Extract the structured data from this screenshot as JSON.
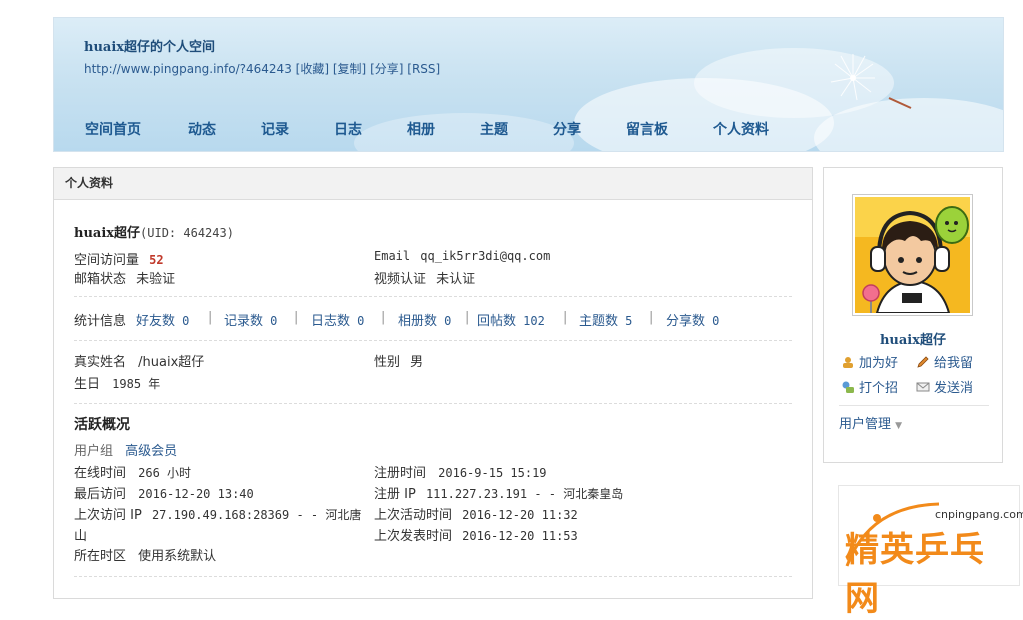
{
  "header": {
    "title": "huaix超仔的个人空间",
    "url": "http://www.pingpang.info/?464243",
    "url_links": [
      "[收藏]",
      "[复制]",
      "[分享]",
      "[RSS]"
    ]
  },
  "nav": [
    "空间首页",
    "动态",
    "记录",
    "日志",
    "相册",
    "主题",
    "分享",
    "留言板",
    "个人资料"
  ],
  "main": {
    "head_title": "个人资料",
    "username": "huaix超仔",
    "uid": "(UID: 464243)",
    "visits_label": "空间访问量",
    "visits_value": "52",
    "email_label": "Email",
    "email_value": "qq_ik5rr3di@qq.com",
    "mail_status_label": "邮箱状态",
    "mail_status_value": "未验证",
    "video_label": "视频认证",
    "video_value": "未认证",
    "stats_label": "统计信息",
    "stats": [
      {
        "label": "好友数",
        "value": "0"
      },
      {
        "label": "记录数",
        "value": "0"
      },
      {
        "label": "日志数",
        "value": "0"
      },
      {
        "label": "相册数",
        "value": "0"
      },
      {
        "label": "回帖数",
        "value": "102"
      },
      {
        "label": "主题数",
        "value": "5"
      },
      {
        "label": "分享数",
        "value": "0"
      }
    ],
    "realname_label": "真实姓名",
    "realname_value": "/huaix超仔",
    "gender_label": "性别",
    "gender_value": "男",
    "birthday_label": "生日",
    "birthday_value": "1985 年",
    "activity_title": "活跃概况",
    "group_label": "用户组",
    "group_value": "高级会员",
    "online_label": "在线时间",
    "online_value": "266 小时",
    "reg_time_label": "注册时间",
    "reg_time_value": "2016-9-15 15:19",
    "last_visit_label": "最后访问",
    "last_visit_value": "2016-12-20 13:40",
    "reg_ip_label": "注册 IP",
    "reg_ip_value": "111.227.23.191 - - 河北秦皇岛",
    "prev_ip_label": "上次访问 IP",
    "prev_ip_value": "27.190.49.168:28369 - - 河北唐",
    "prev_ip_wrap": "山",
    "last_active_label": "上次活动时间",
    "last_active_value": "2016-12-20 11:32",
    "last_post_label": "上次发表时间",
    "last_post_value": "2016-12-20 11:53",
    "tz_label": "所在时区",
    "tz_value": "使用系统默认"
  },
  "sidebar": {
    "name": "huaix超仔",
    "add_friend": "加为好",
    "leave_msg": "给我留",
    "greet": "打个招",
    "send_msg": "发送消",
    "user_manage": "用户管理"
  },
  "ad": {
    "domain": "cnpingpang.com",
    "brand": "精英乒乓网"
  },
  "colors": {
    "accent": "#2b5a8f",
    "visits": "#c0392b",
    "nav": "#1e5990"
  }
}
